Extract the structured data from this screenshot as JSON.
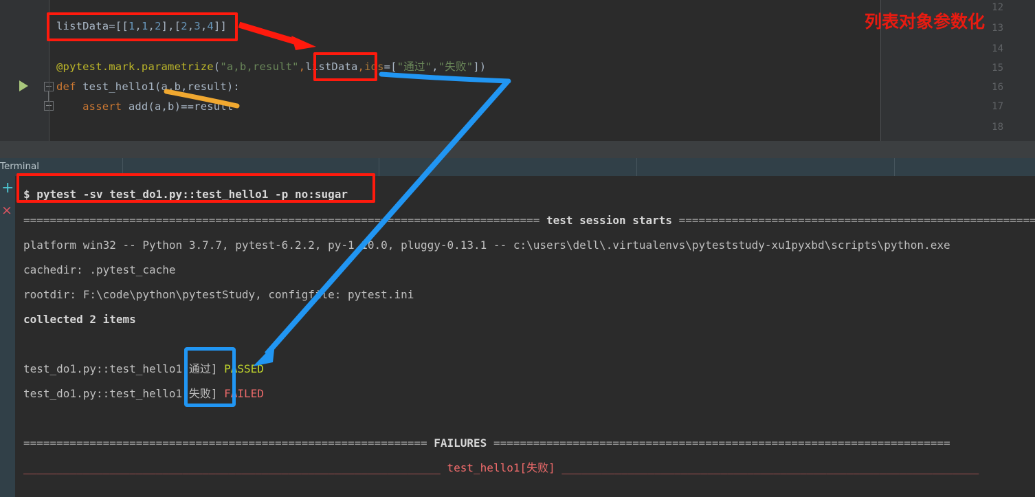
{
  "editor": {
    "line_numbers": [
      "12",
      "13",
      "14",
      "15",
      "16",
      "17",
      "18"
    ],
    "code": {
      "l13_a": "listData=",
      "l13_b": "[[",
      "l13_c": "1",
      "l13_d": ",",
      "l13_e": "1",
      "l13_f": ",",
      "l13_g": "2",
      "l13_h": "],[",
      "l13_i": "2",
      "l13_j": ",",
      "l13_k": "3",
      "l13_l": ",",
      "l13_m": "4",
      "l13_n": "]]",
      "l15_dec": "@pytest.mark.parametrize",
      "l15_p1": "(",
      "l15_str1": "\"a,b,result\"",
      "l15_comma1": ",",
      "l15_var": "listData",
      "l15_comma2": ",",
      "l15_kwarg": "ids",
      "l15_eq": "=[",
      "l15_str2": "\"通过\"",
      "l15_comma3": ",",
      "l15_str3": "\"失败\"",
      "l15_end": "])",
      "l16_kw": "def ",
      "l16_fn": "test_hello1",
      "l16_sig": "(a,b,result):",
      "l17_kw": "    assert ",
      "l17_rest": "add(a,b)==result"
    },
    "annotation_note": "列表对象参数化"
  },
  "toolwindow": {
    "tab_label": "Terminal",
    "add_icon": "+",
    "close_icon": "×"
  },
  "terminal": {
    "prompt": "$ ",
    "command": "pytest -sv test_do1.py::test_hello1 -p no:sugar",
    "sep_left": "==============================================================================",
    "sep_title": " test session starts ",
    "sep_right": "==============================================================================",
    "platform": "platform win32 -- Python 3.7.7, pytest-6.2.2, py-1.10.0, pluggy-0.13.1 -- c:\\users\\dell\\.virtualenvs\\pyteststudy-xu1pyxbd\\scripts\\python.exe",
    "cachedir": "cachedir: .pytest_cache",
    "rootdir": "rootdir: F:\\code\\python\\pytestStudy, configfile: pytest.ini",
    "collected": "collected 2 items",
    "results": [
      {
        "nodeid": "test_do1.py::test_hello1[通过] ",
        "status": "PASSED",
        "status_kind": "pass"
      },
      {
        "nodeid": "test_do1.py::test_hello1[失败] ",
        "status": "FAILED",
        "status_kind": "fail"
      }
    ],
    "failures_left": "=============================================================",
    "failures_title": " FAILURES ",
    "failures_right": "=====================================================================",
    "failure_rule_left": "_______________________________________________________________",
    "failure_name": " test_hello1[失败] ",
    "failure_rule_right": "_______________________________________________________________"
  },
  "colors": {
    "annotation_red": "#ff1a0d",
    "annotation_blue": "#2196f3",
    "annotation_orange": "#f0a830",
    "passed": "#c3d82c",
    "failed": "#ef6b6b",
    "editor_bg": "#2b2b2b",
    "tab_bg": "#314048"
  }
}
